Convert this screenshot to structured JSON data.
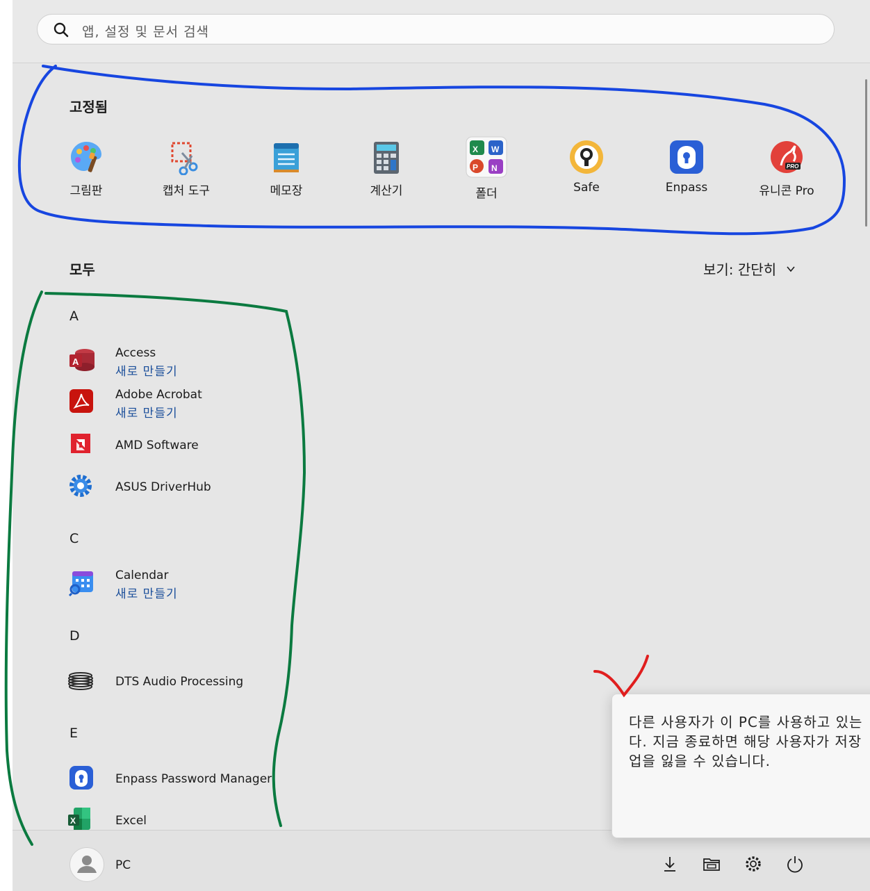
{
  "search": {
    "placeholder": "앱, 설정 및 문서 검색",
    "icon": "search-icon"
  },
  "pinned": {
    "title": "고정됨",
    "items": [
      {
        "label": "그림판",
        "icon": "paint-icon"
      },
      {
        "label": "캡처 도구",
        "icon": "snipping-tool-icon"
      },
      {
        "label": "메모장",
        "icon": "notepad-icon"
      },
      {
        "label": "계산기",
        "icon": "calculator-icon"
      },
      {
        "label": "폴더",
        "icon": "office-folder-icon"
      },
      {
        "label": "Safe",
        "icon": "safe-icon"
      },
      {
        "label": "Enpass",
        "icon": "enpass-icon"
      },
      {
        "label": "유니콘 Pro",
        "icon": "unicorn-pro-icon"
      }
    ]
  },
  "all": {
    "title": "모두",
    "view_label": "보기: 간단히",
    "groups": [
      {
        "letter": "A",
        "apps": [
          {
            "name": "Access",
            "sub": "새로 만들기",
            "icon": "access-icon"
          },
          {
            "name": "Adobe Acrobat",
            "sub": "새로 만들기",
            "icon": "acrobat-icon"
          },
          {
            "name": "AMD Software",
            "icon": "amd-icon"
          },
          {
            "name": "ASUS DriverHub",
            "icon": "gear-icon"
          }
        ]
      },
      {
        "letter": "C",
        "apps": [
          {
            "name": "Calendar",
            "sub": "새로 만들기",
            "icon": "calendar-icon"
          }
        ]
      },
      {
        "letter": "D",
        "apps": [
          {
            "name": "DTS Audio Processing",
            "icon": "dts-icon"
          }
        ]
      },
      {
        "letter": "E",
        "apps": [
          {
            "name": "Enpass Password Manager",
            "icon": "enpass-icon"
          },
          {
            "name": "Excel",
            "icon": "excel-icon"
          }
        ]
      }
    ]
  },
  "user": {
    "name": "PC"
  },
  "bottom_icons": [
    "download-icon",
    "file-explorer-icon",
    "settings-icon",
    "power-icon"
  ],
  "toast": {
    "text": "다른 사용자가 이 PC를 사용하고 있는\n다. 지금 종료하면 해당 사용자가 저장\n업을 잃을 수 있습니다."
  },
  "colors": {
    "panel": "#e6e6e6",
    "link": "#1a4e9a",
    "annotation_blue": "#1746e0",
    "annotation_green": "#0b7a40",
    "annotation_red": "#e01e1e"
  }
}
